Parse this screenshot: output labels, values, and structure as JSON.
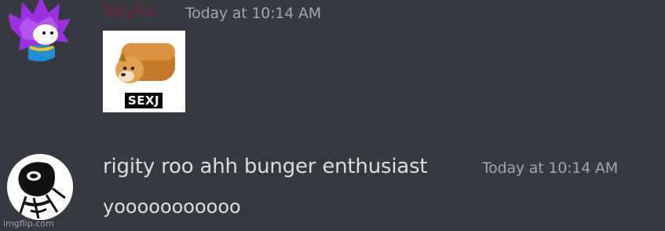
{
  "messages": [
    {
      "username": "bayku",
      "timestamp": "Today at 10:14 AM",
      "attachment": {
        "caption": "SEXJ"
      }
    },
    {
      "username": "rigity roo ahh bunger enthusiast",
      "timestamp": "Today at 10:14 AM",
      "content": "yooooooooooo"
    }
  ],
  "watermark": "imgflip.com",
  "colors": {
    "background": "#36393f",
    "username1": "#7a1f3d",
    "username2": "#dcddde",
    "timestamp": "#a3a6aa",
    "avatar1_hair": "#9b30e0"
  }
}
